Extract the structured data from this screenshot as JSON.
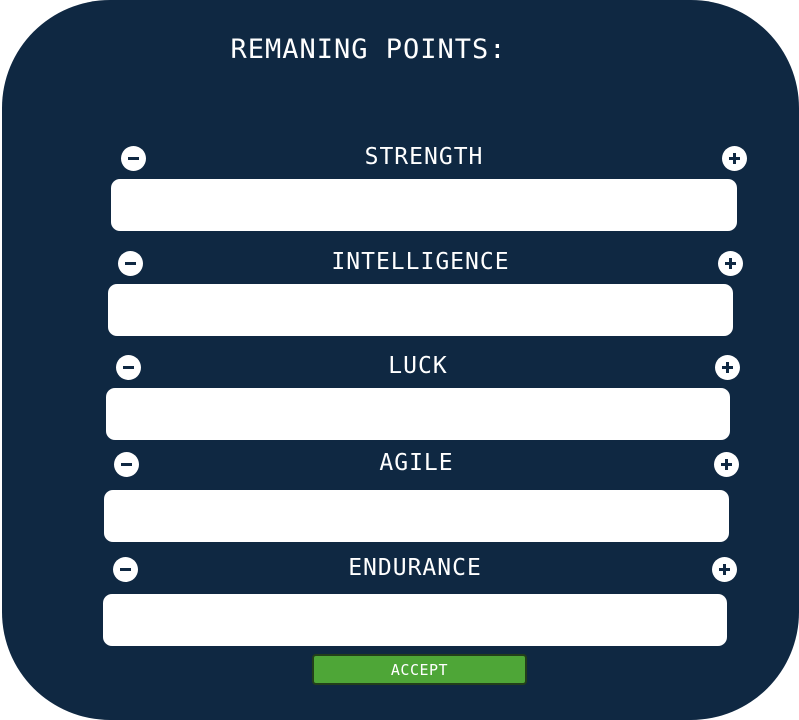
{
  "header": {
    "title": "REMANING POINTS:"
  },
  "stats": [
    {
      "label": "STRENGTH",
      "value": ""
    },
    {
      "label": "INTELLIGENCE",
      "value": ""
    },
    {
      "label": "LUCK",
      "value": ""
    },
    {
      "label": "AGILE",
      "value": ""
    },
    {
      "label": "ENDURANCE",
      "value": ""
    }
  ],
  "actions": {
    "accept_label": "ACCEPT"
  },
  "colors": {
    "panel": "#0f2842",
    "accept": "#4ea637",
    "field": "#ffffff",
    "text": "#ffffff"
  },
  "icons": {
    "decrease": "minus-circle-icon",
    "increase": "plus-circle-icon"
  }
}
